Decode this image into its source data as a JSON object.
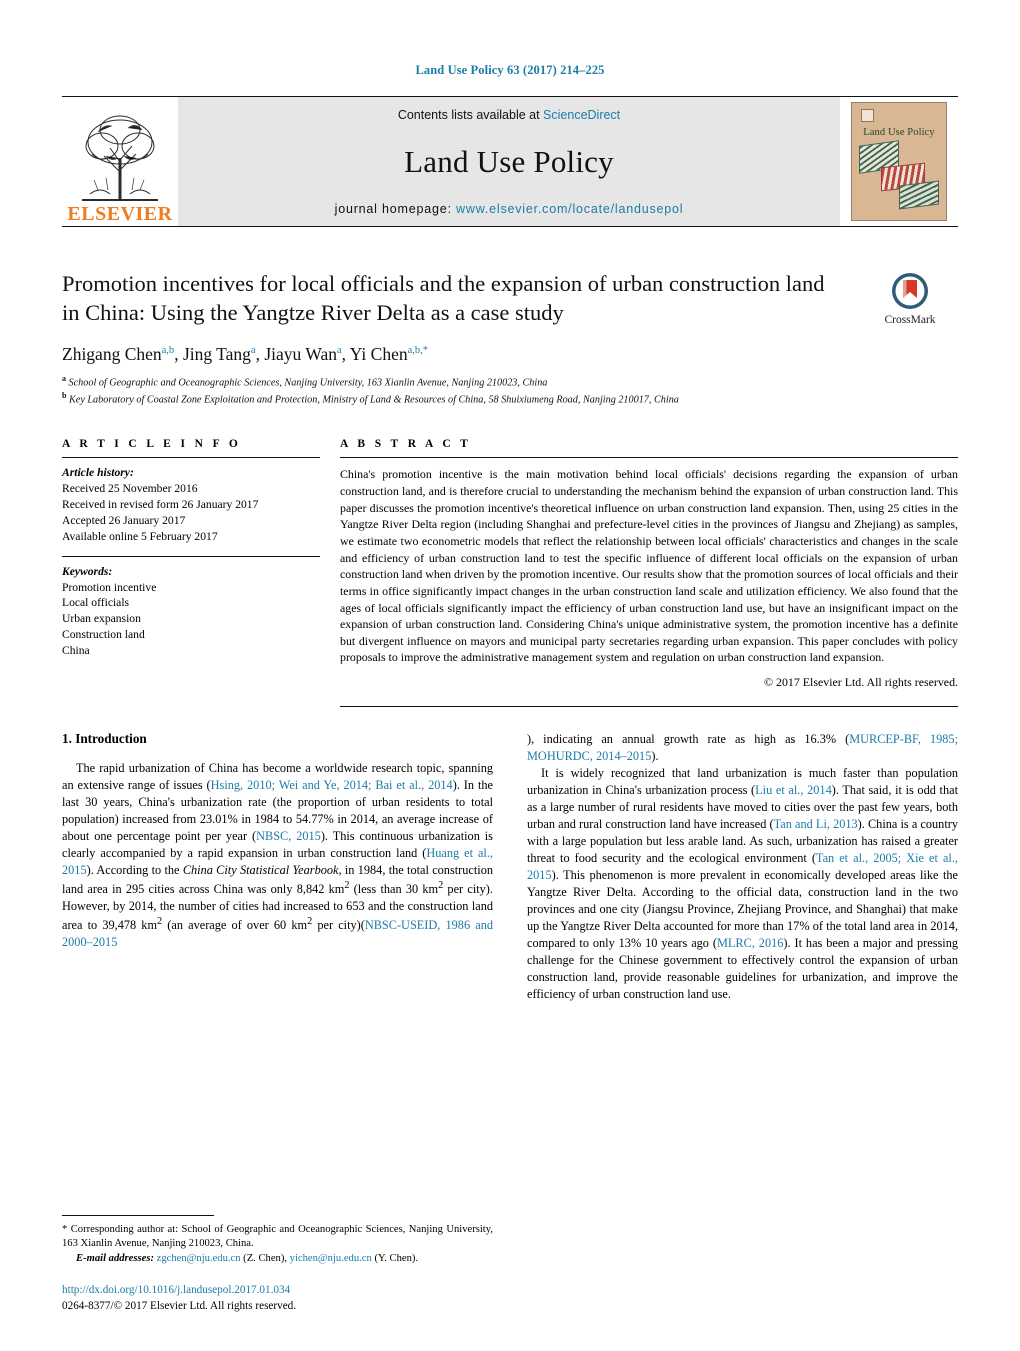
{
  "running_head": "Land Use Policy 63 (2017) 214–225",
  "masthead": {
    "publisher": "ELSEVIER",
    "contents_prefix": "Contents lists available at ",
    "contents_link": "ScienceDirect",
    "journal_title": "Land Use Policy",
    "homepage_prefix": "journal homepage: ",
    "homepage_url": "www.elsevier.com/locate/landusepol",
    "cover_title": "Land Use Policy"
  },
  "article": {
    "title": "Promotion incentives for local officials and the expansion of urban construction land in China: Using the Yangtze River Delta as a case study",
    "crossmark_label": "CrossMark",
    "authors_html": "Zhigang Chen<sup>a,b</sup>, Jing Tang<sup>a</sup>, Jiayu Wan<sup>a</sup>, Yi Chen<sup>a,b,</sup><sup>*</sup>",
    "affiliation_a": "School of Geographic and Oceanographic Sciences, Nanjing University, 163 Xianlin Avenue, Nanjing 210023, China",
    "affiliation_b": "Key Laboratory of Coastal Zone Exploitation and Protection, Ministry of Land & Resources of China, 58 Shuixiumeng Road, Nanjing 210017, China"
  },
  "article_info": {
    "heading": "A R T I C L E   I N F O",
    "history_label": "Article history:",
    "history": [
      "Received 25 November 2016",
      "Received in revised form 26 January 2017",
      "Accepted 26 January 2017",
      "Available online 5 February 2017"
    ],
    "keywords_label": "Keywords:",
    "keywords": [
      "Promotion incentive",
      "Local officials",
      "Urban expansion",
      "Construction land",
      "China"
    ]
  },
  "abstract": {
    "heading": "A B S T R A C T",
    "text": "China's promotion incentive is the main motivation behind local officials' decisions regarding the expansion of urban construction land, and is therefore crucial to understanding the mechanism behind the expansion of urban construction land. This paper discusses the promotion incentive's theoretical influence on urban construction land expansion. Then, using 25 cities in the Yangtze River Delta region (including Shanghai and prefecture-level cities in the provinces of Jiangsu and Zhejiang) as samples, we estimate two econometric models that reflect the relationship between local officials' characteristics and changes in the scale and efficiency of urban construction land to test the specific influence of different local officials on the expansion of urban construction land when driven by the promotion incentive. Our results show that the promotion sources of local officials and their terms in office significantly impact changes in the urban construction land scale and utilization efficiency. We also found that the ages of local officials significantly impact the efficiency of urban construction land use, but have an insignificant impact on the expansion of urban construction land. Considering China's unique administrative system, the promotion incentive has a definite but divergent influence on mayors and municipal party secretaries regarding urban expansion. This paper concludes with policy proposals to improve the administrative management system and regulation on urban construction land expansion.",
    "copyright": "© 2017 Elsevier Ltd. All rights reserved."
  },
  "introduction": {
    "heading": "1.  Introduction",
    "left_para_1_a": "The rapid urbanization of China has become a worldwide research topic, spanning an extensive range of issues (",
    "left_cite_1": "Hsing, 2010; Wei and Ye, 2014; Bai et al., 2014",
    "left_para_1_b": "). In the last 30 years, China's urbanization rate (the proportion of urban residents to total population) increased from 23.01% in 1984 to 54.77% in 2014, an average increase of about one percentage point per year (",
    "left_cite_2": "NBSC, 2015",
    "left_para_1_c": "). This continuous urbanization is clearly accompanied by a rapid expansion in urban construction land (",
    "left_cite_3": "Huang et al., 2015",
    "left_para_1_d": "). According to the ",
    "left_italic_1": "China City Statistical Yearbook",
    "left_para_1_e": ", in 1984, the total construction land area in 295 cities across China was only 8,842 km",
    "left_para_1_f": " (less than 30 km",
    "left_para_1_g": " per city). However, by 2014, the number of cities had increased to 653 and the construction land area to 39,478 km",
    "left_para_1_h": " (an average of over 60 km",
    "left_para_1_i": " per city)(",
    "left_cite_4": "NBSC-USEID, 1986 and 2000–2015",
    "right_para_1_a": "), indicating an annual growth rate as high as 16.3% (",
    "right_cite_1": "MURCEP-BF, 1985; MOHURDC, 2014–2015",
    "right_para_1_b": ").",
    "right_para_2_a": "It is widely recognized that land urbanization is much faster than population urbanization in China's urbanization process (",
    "right_cite_2": "Liu et al., 2014",
    "right_para_2_b": "). That said, it is odd that as a large number of rural residents have moved to cities over the past few years, both urban and rural construction land have increased (",
    "right_cite_3": "Tan and Li, 2013",
    "right_para_2_c": "). China is a country with a large population but less arable land. As such, urbanization has raised a greater threat to food security and the ecological environment (",
    "right_cite_4": "Tan et al., 2005; Xie et al., 2015",
    "right_para_2_d": "). This phenomenon is more prevalent in economically developed areas like the Yangtze River Delta. According to the official data, construction land in the two provinces and one city (Jiangsu Province, Zhejiang Province, and Shanghai) that make up the Yangtze River Delta accounted for more than 17% of the total land area in 2014, compared to only 13% 10 years ago (",
    "right_cite_5": "MLRC, 2016",
    "right_para_2_e": "). It has been a major and pressing challenge for the Chinese government to effectively control the expansion of urban construction land, provide reasonable guidelines for urbanization, and improve the efficiency of urban construction land use."
  },
  "footnotes": {
    "corresponding": "*  Corresponding author at: School of Geographic and Oceanographic Sciences, Nanjing University, 163 Xianlin Avenue, Nanjing 210023, China.",
    "email_label": "E-mail addresses:",
    "email_1": "zgchen@nju.edu.cn",
    "email_1_name": " (Z. Chen), ",
    "email_2": "yichen@nju.edu.cn",
    "email_2_name": " (Y. Chen).",
    "doi": "http://dx.doi.org/10.1016/j.landusepol.2017.01.034",
    "issn": "0264-8377/© 2017 Elsevier Ltd. All rights reserved."
  },
  "colors": {
    "link_blue": "#1b7ca8",
    "elsevier_orange": "#ef7d20",
    "masthead_gray": "#e6e6e6",
    "cover_tan": "#d9b694"
  }
}
